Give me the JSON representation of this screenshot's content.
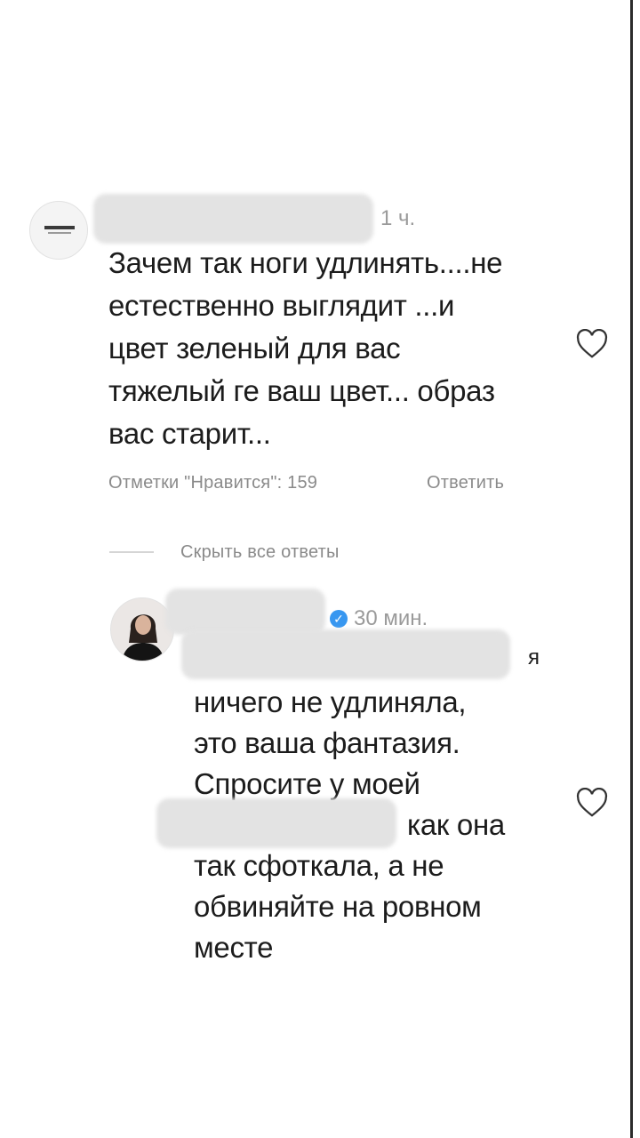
{
  "comment": {
    "time": "1 ч.",
    "lines": [
      "Зачем так ноги удлинять....не",
      "естественно выглядит ...и",
      "цвет зеленый для вас",
      "тяжелый ге ваш цвет... образ",
      "вас старит..."
    ],
    "likes_label": "Отметки \"Нравится\": 159",
    "reply_label": "Ответить",
    "heart_icon": "heart-outline-icon"
  },
  "replies_toggle": {
    "label": "Скрыть все ответы"
  },
  "reply": {
    "time": "30 мин.",
    "verified_mark": "✓",
    "line1_tail": "я",
    "lines": [
      "ничего не удлиняла,",
      "это ваша фантазия.",
      "Спросите у моей"
    ],
    "line5_tail": "как она",
    "lines_end": [
      "так сфоткала, а не",
      "обвиняйте на ровном",
      "месте"
    ],
    "heart_icon": "heart-outline-icon"
  },
  "colors": {
    "background": "#ffffff",
    "text": "#1c1c1c",
    "meta": "#8a8a8a",
    "verified": "#3897f0"
  }
}
